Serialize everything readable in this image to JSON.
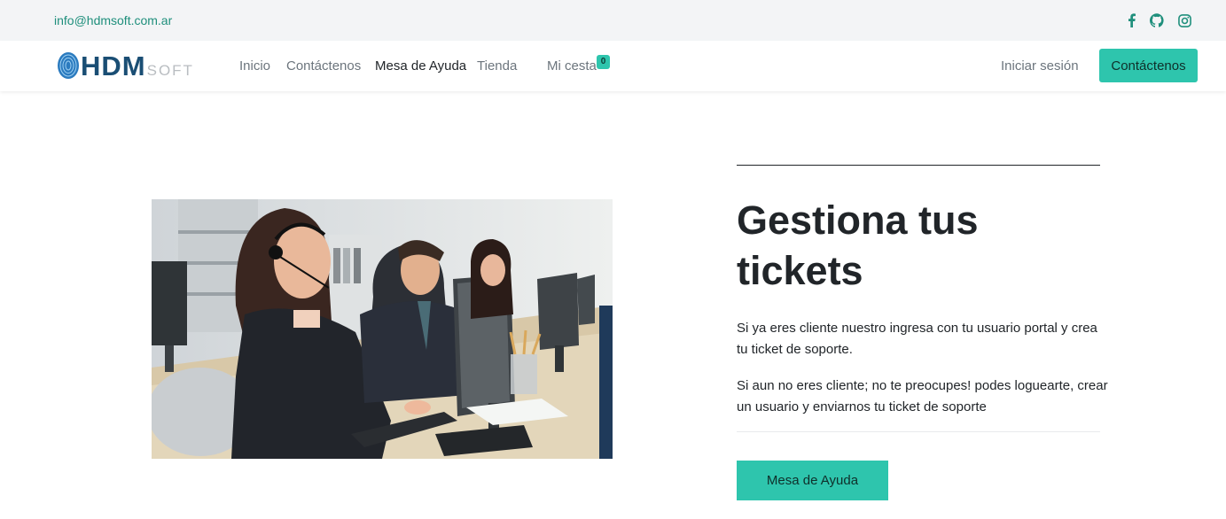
{
  "topbar": {
    "email": "info@hdmsoft.com.ar",
    "social": [
      {
        "icon": "facebook-icon"
      },
      {
        "icon": "github-icon"
      },
      {
        "icon": "instagram-icon"
      }
    ],
    "icon_color": "#1f8f7c"
  },
  "navbar": {
    "logo": {
      "main": "HDM",
      "sub": "SOFT"
    },
    "links": [
      "Inicio",
      "Contáctenos",
      "Mesa de Ayuda",
      "Tienda",
      "Mi cesta"
    ],
    "active_link": "Mesa de Ayuda",
    "cart_count": "0",
    "signin_label": "Iniciar sesión",
    "contact_button": "Contáctenos"
  },
  "hero": {
    "image": "call-center-agents-photo",
    "title": "Gestiona tus tickets",
    "paragraph1": "Si ya eres cliente nuestro ingresa con tu usuario portal y crea tu ticket de soporte.",
    "paragraph2": "Si aun no eres cliente; no te preocupes! podes loguearte, crear un usuario y enviarnos tu ticket de soporte",
    "button_label": "Mesa de Ayuda"
  },
  "colors": {
    "accent": "#2ec5ad",
    "topbar_bg": "#f3f4f6",
    "text_dark": "#212529",
    "text_muted": "#6c757d",
    "logo_blue": "#1a4e74"
  }
}
